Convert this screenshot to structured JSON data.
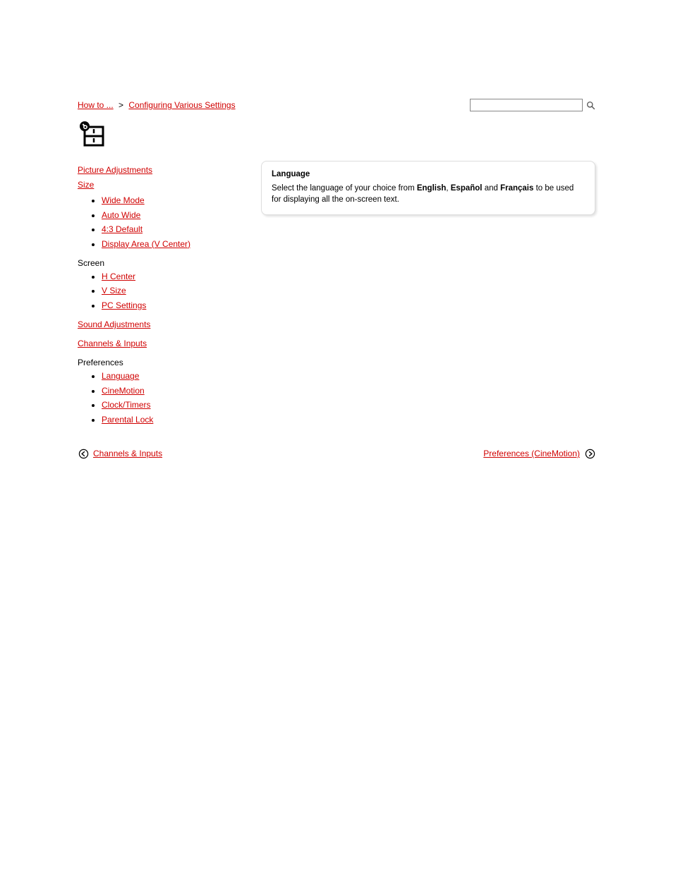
{
  "breadcrumb": {
    "item1": "How to ...",
    "item2": "Configuring Various Settings",
    "sep": ">"
  },
  "search": {
    "placeholder": ""
  },
  "sidebar": {
    "section1": "Picture Adjustments",
    "sub1": "Size",
    "items1": [
      "Wide Mode",
      "Auto Wide",
      "4:3 Default",
      "Display Area (V Center)"
    ],
    "plain1": "Screen",
    "items2": [
      "H Center",
      "V Size",
      "PC Settings"
    ],
    "section2": "Sound Adjustments",
    "section3": "Channels & Inputs",
    "plain2": "Preferences",
    "items3": [
      "Language",
      "CineMotion",
      "Clock/Timers",
      "Parental Lock"
    ]
  },
  "content": {
    "box": {
      "title": "Language",
      "body_pre": "Select the language of your choice from ",
      "opt1": "English",
      "comma1": ", ",
      "opt2": "Español",
      "and": " and ",
      "opt3": "Français",
      "body_post": " to be used for displaying all the on-screen text."
    }
  },
  "pager": {
    "prev": "Channels & Inputs",
    "next": "Preferences (CineMotion)"
  }
}
